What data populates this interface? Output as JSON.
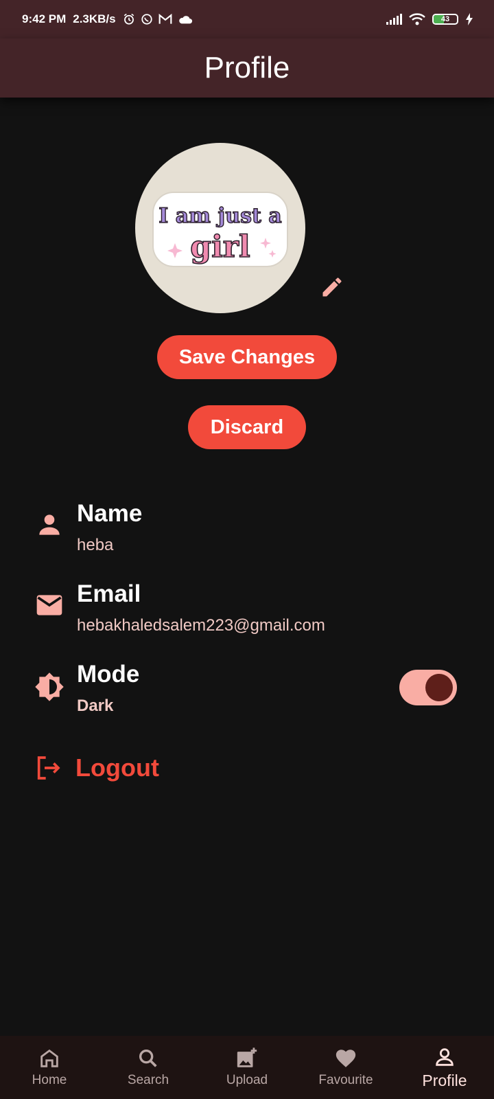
{
  "status_bar": {
    "time": "9:42 PM",
    "net_speed": "2.3KB/s",
    "battery": "43",
    "battery_level_percent": 43,
    "icons": [
      "alarm-icon",
      "whatsapp-icon",
      "gmail-icon",
      "cloud-icon",
      "signal-icon",
      "wifi-icon",
      "battery-icon",
      "charging-icon"
    ]
  },
  "app_bar": {
    "title": "Profile"
  },
  "avatar": {
    "sticker_line1": "I am just a",
    "sticker_line2": "girl"
  },
  "buttons": {
    "save": "Save Changes",
    "discard": "Discard"
  },
  "profile": {
    "name_label": "Name",
    "name_value": "heba",
    "email_label": "Email",
    "email_value": "hebakhaledsalem223@gmail.com",
    "mode_label": "Mode",
    "mode_value": "Dark",
    "mode_toggle_on": true
  },
  "logout_label": "Logout",
  "bottom_nav": {
    "items": [
      {
        "label": "Home",
        "icon": "home-icon"
      },
      {
        "label": "Search",
        "icon": "search-icon"
      },
      {
        "label": "Upload",
        "icon": "add-photo-icon"
      },
      {
        "label": "Favourite",
        "icon": "heart-icon"
      },
      {
        "label": "Profile",
        "icon": "person-icon"
      }
    ],
    "active_index": 4
  },
  "colors": {
    "app_bar_bg": "#442428",
    "background": "#121212",
    "accent_button": "#f24a3b",
    "icon_pink": "#f9ada4",
    "toggle_knob": "#5e1f1a",
    "nav_bg": "#1e1312"
  }
}
